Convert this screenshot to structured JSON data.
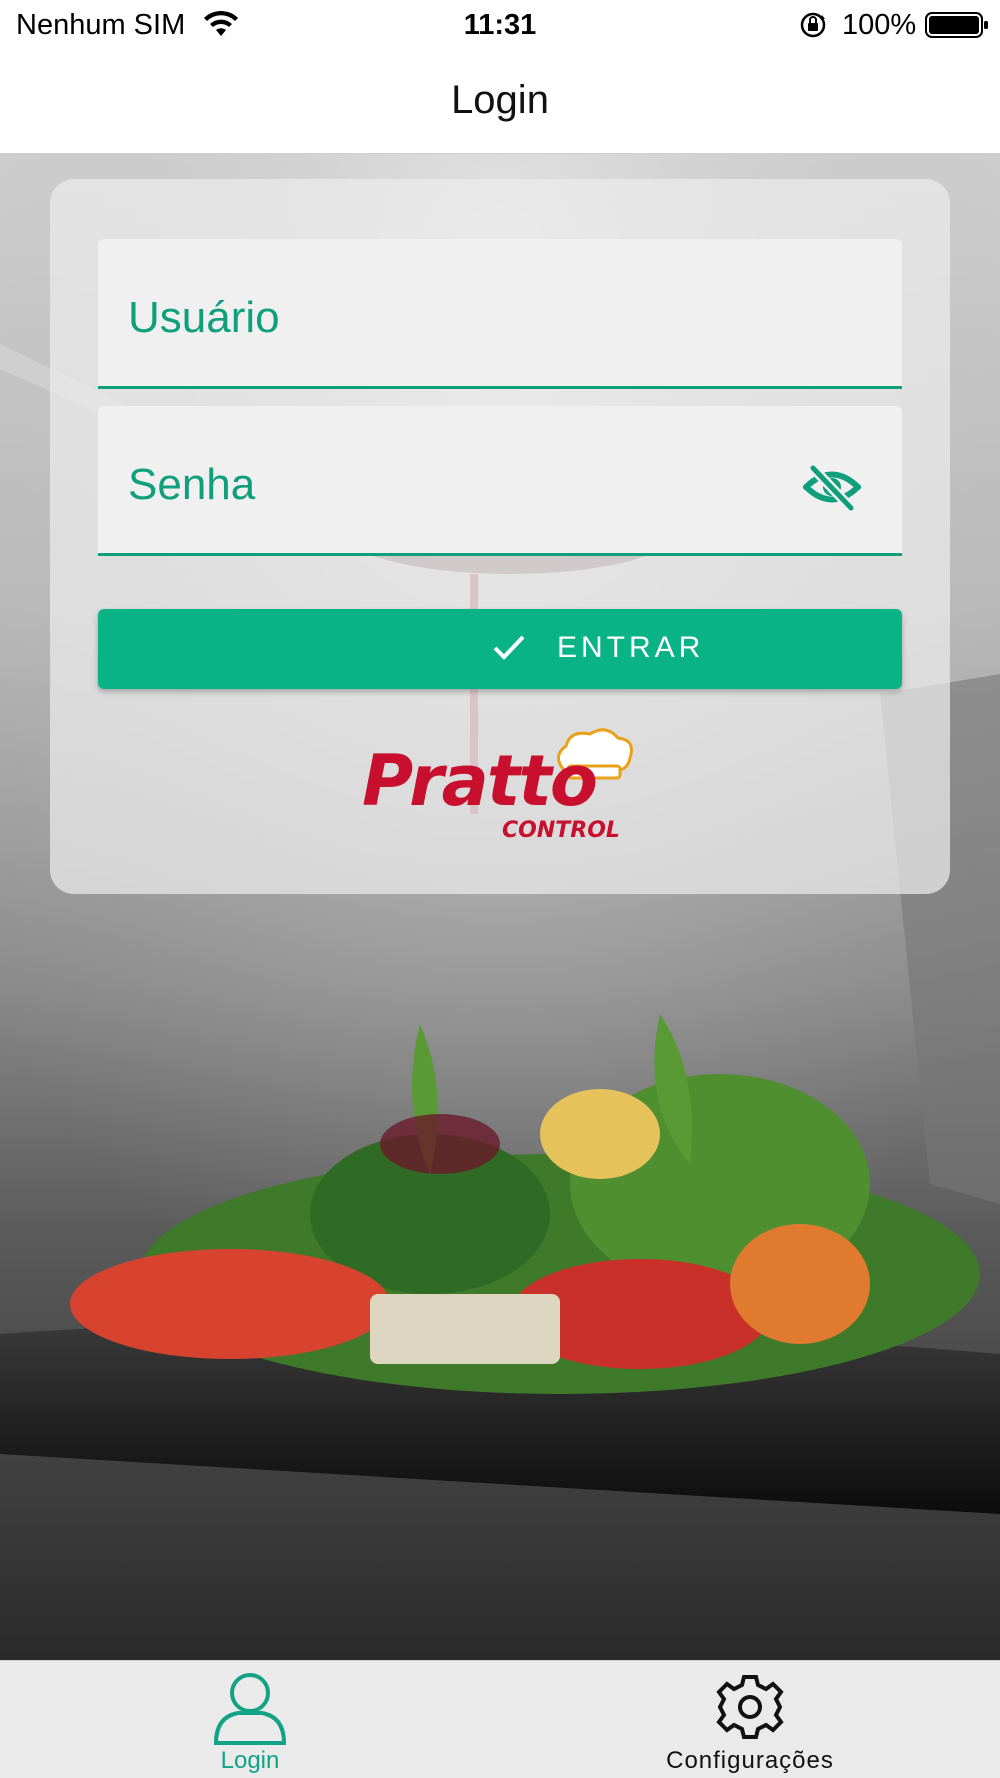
{
  "status_bar": {
    "carrier": "Nenhum SIM",
    "time": "11:31",
    "battery": "100%"
  },
  "nav": {
    "title": "Login"
  },
  "form": {
    "username_placeholder": "Usuário",
    "password_placeholder": "Senha",
    "submit_label": "ENTRAR"
  },
  "logo": {
    "wordmark": "Pratto",
    "sub": "CONTROL"
  },
  "tabs": [
    {
      "label": "Login",
      "icon": "user-icon",
      "active": true
    },
    {
      "label": "Configurações",
      "icon": "gear-icon",
      "active": false
    }
  ],
  "colors": {
    "accent": "#0ab386",
    "accent_text": "#0f9f7c",
    "brand_red": "#c8102e"
  }
}
